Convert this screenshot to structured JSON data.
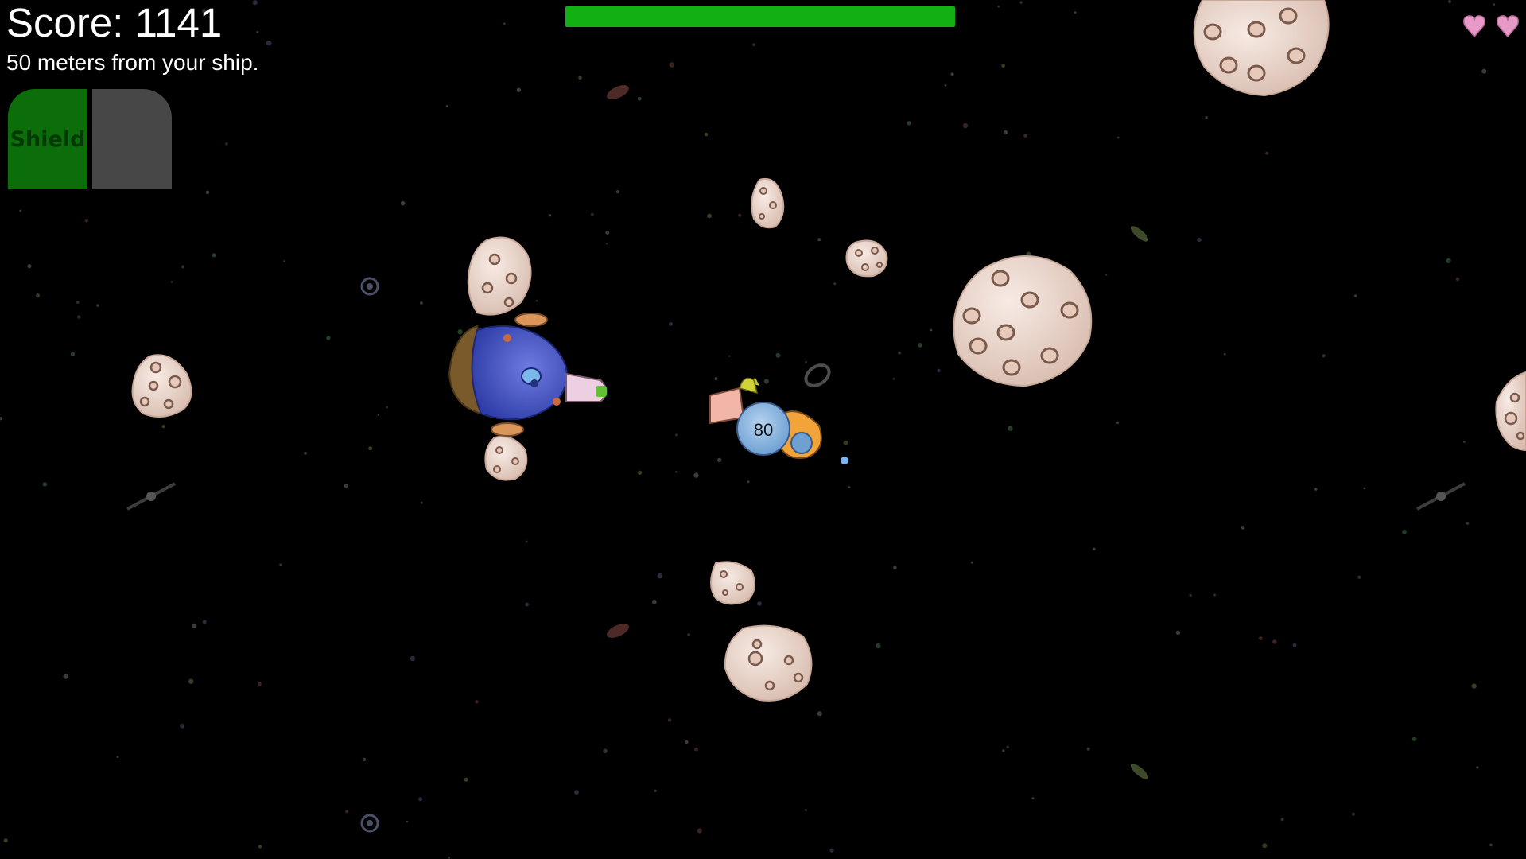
{
  "hud": {
    "score_text": "Score: 1141",
    "distance_text": "50 meters from your ship.",
    "health_fraction": 1.0,
    "lives": 2
  },
  "abilities": {
    "shield_label": "Shield"
  },
  "player": {
    "number": "80"
  },
  "colors": {
    "health_green": "#12b012",
    "shield_green": "#0b6e0b",
    "heart_pink": "#e79ac8",
    "asteroid_fill": "#efdcd2",
    "enemy_blue": "#4a58c9"
  },
  "icons": [
    "heart-icon",
    "asteroid",
    "spaceship",
    "astronaut-player",
    "galaxy"
  ]
}
